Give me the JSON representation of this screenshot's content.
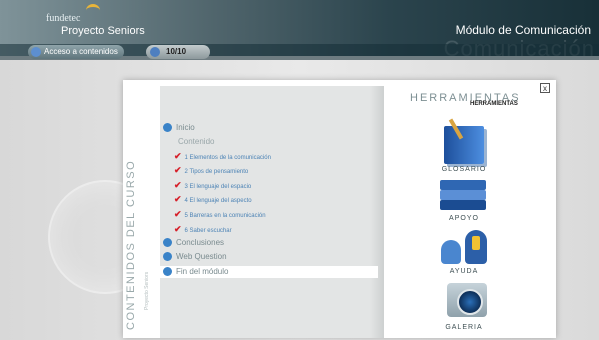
{
  "header": {
    "brand": "fundetec",
    "subtitle": "Proyecto Seniors",
    "module_title": "Módulo de Comunicación",
    "watermark": "Comunicación"
  },
  "nav": {
    "access_label": "Acceso a contenidos",
    "counter": "10/10"
  },
  "course": {
    "vertical_title": "CONTENIDOS DEL CURSO",
    "vertical_sub": "Proyecto Seniors",
    "menu": {
      "inicio": "Inicio",
      "contenido": "Contenido",
      "subitems": [
        "1 Elementos de la comunicación",
        "2 Tipos de pensamiento",
        "3 El lenguaje del espacio",
        "4 El lenguaje del aspecto",
        "5 Barreras en la comunicación",
        "6 Saber escuchar"
      ],
      "conclusiones": "Conclusiones",
      "web_quest": "Web Question",
      "fin": "Fin del módulo"
    }
  },
  "tools": {
    "title": "Herramientas",
    "subtitle": "Herramientas",
    "close": "x",
    "glosario": "Glosario",
    "apoyo": "Apoyo",
    "ayuda": "Ayuda",
    "galeria": "Galeria"
  },
  "colors": {
    "accent": "#3a83c8",
    "check": "#d6202a"
  }
}
